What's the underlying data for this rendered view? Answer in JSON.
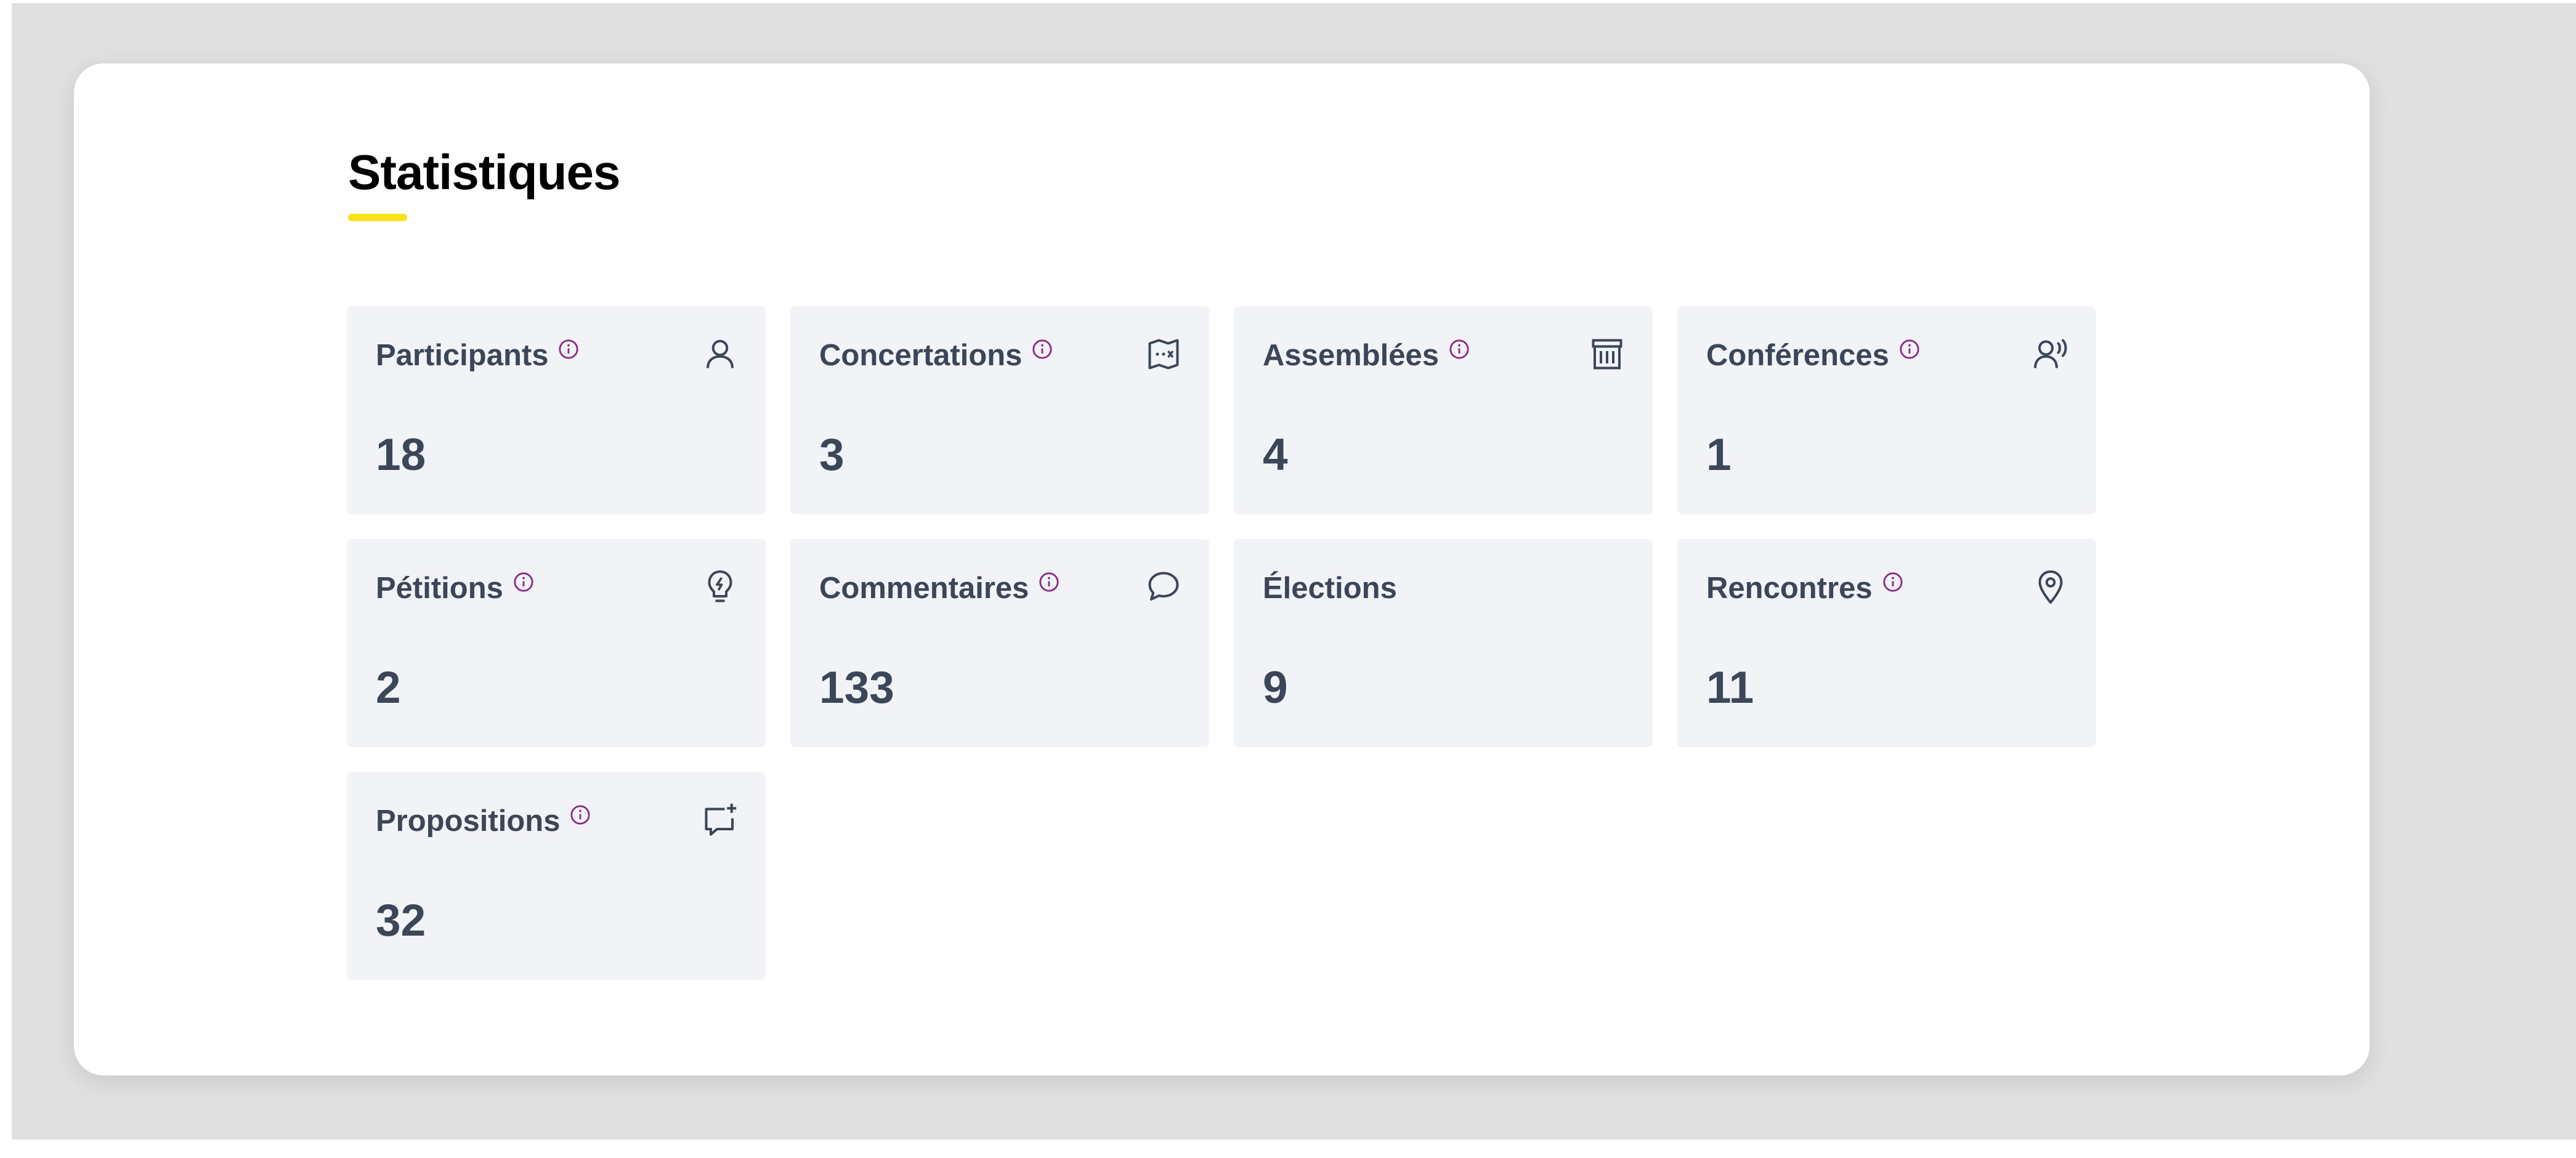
{
  "section": {
    "title": "Statistiques",
    "accent_color": "#f8e21a",
    "info_icon_color": "#8a2b86"
  },
  "stats": [
    {
      "label": "Participants",
      "value": "18",
      "has_info": true,
      "icon": "person-icon"
    },
    {
      "label": "Concertations",
      "value": "3",
      "has_info": true,
      "icon": "map-icon"
    },
    {
      "label": "Assemblées",
      "value": "4",
      "has_info": true,
      "icon": "building-icon"
    },
    {
      "label": "Conférences",
      "value": "1",
      "has_info": true,
      "icon": "speaker-icon"
    },
    {
      "label": "Pétitions",
      "value": "2",
      "has_info": true,
      "icon": "lightbulb-icon"
    },
    {
      "label": "Commentaires",
      "value": "133",
      "has_info": true,
      "icon": "speech-bubble-icon"
    },
    {
      "label": "Élections",
      "value": "9",
      "has_info": false,
      "icon": ""
    },
    {
      "label": "Rencontres",
      "value": "11",
      "has_info": true,
      "icon": "map-pin-icon"
    },
    {
      "label": "Propositions",
      "value": "32",
      "has_info": true,
      "icon": "chat-add-icon"
    }
  ]
}
